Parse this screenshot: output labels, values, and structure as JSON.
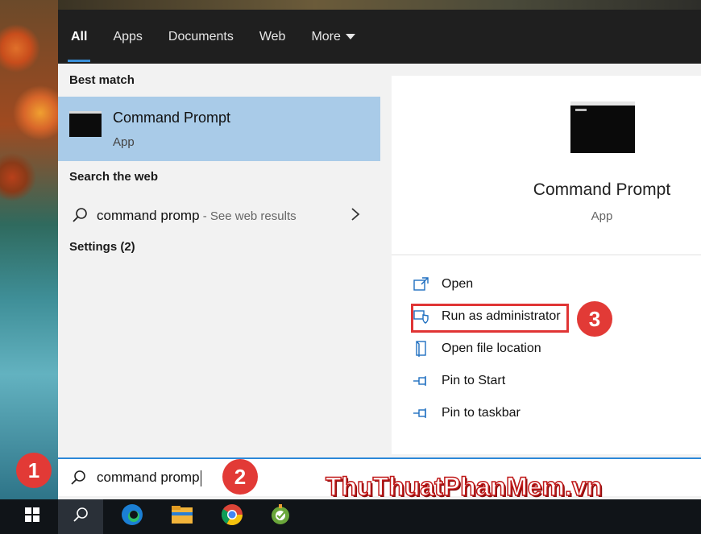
{
  "tabs": [
    {
      "label": "All",
      "active": true
    },
    {
      "label": "Apps"
    },
    {
      "label": "Documents"
    },
    {
      "label": "Web"
    },
    {
      "label": "More"
    }
  ],
  "left": {
    "best_match_title": "Best match",
    "best_item_title": "Command Prompt",
    "best_item_sub": "App",
    "search_web_title": "Search the web",
    "web_query": "command promp",
    "web_hint": " - See web results",
    "settings_title": "Settings (2)"
  },
  "right": {
    "app_title": "Command Prompt",
    "app_sub": "App",
    "actions": [
      {
        "label": "Open",
        "icon": "open-window-icon"
      },
      {
        "label": "Run as administrator",
        "icon": "shield-admin-icon"
      },
      {
        "label": "Open file location",
        "icon": "file-location-icon"
      },
      {
        "label": "Pin to Start",
        "icon": "pin-icon"
      },
      {
        "label": "Pin to taskbar",
        "icon": "pin-icon"
      }
    ]
  },
  "search": {
    "value": "command promp"
  },
  "badges": [
    "1",
    "2",
    "3"
  ],
  "watermark": {
    "main": "ThuThuatPhanMem",
    "suffix": ".vn"
  },
  "taskbar": {
    "items": [
      "windows-start-icon",
      "search-icon",
      "edge-icon",
      "file-explorer-icon",
      "chrome-icon",
      "snip-tool-icon"
    ]
  },
  "colors": {
    "accent": "#2b88d8",
    "highlight": "#a9cbe8",
    "annotation_red": "#e23a36"
  }
}
